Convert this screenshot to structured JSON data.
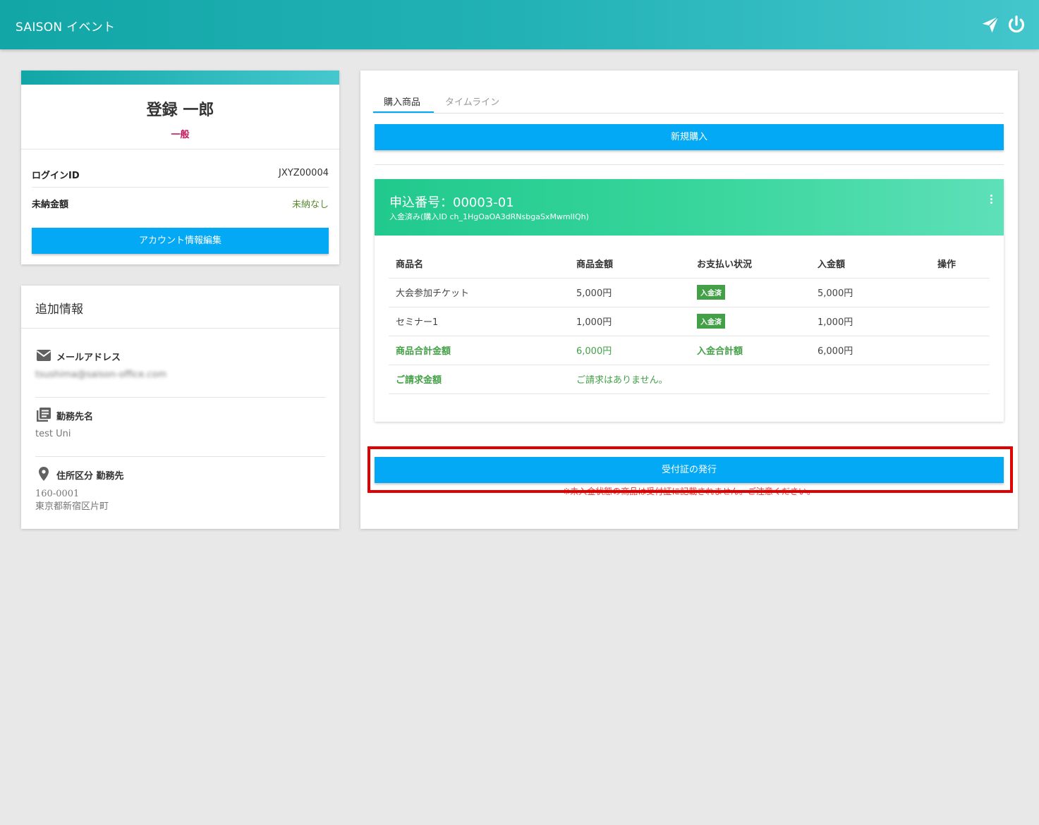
{
  "app": {
    "title": "SAISON イベント"
  },
  "header_icons": {
    "send": "send-icon",
    "power": "power-icon"
  },
  "profile": {
    "name": "登録 一郎",
    "role": "一般",
    "login_label": "ログインID",
    "login_value": "JXYZ00004",
    "unpaid_label": "未納金額",
    "unpaid_value": "未納なし",
    "edit_button": "アカウント情報編集"
  },
  "extra": {
    "title": "追加情報",
    "email_label": "メールアドレス",
    "email_value": "tsushima@saison-office.com",
    "company_label": "勤務先名",
    "company_value": "test Uni",
    "address_label": "住所区分 勤務先",
    "postal": "160-0001",
    "address": "東京都新宿区片町"
  },
  "tabs": [
    {
      "label": "購入商品",
      "active": true
    },
    {
      "label": "タイムライン",
      "active": false
    }
  ],
  "new_purchase_button": "新規購入",
  "order": {
    "title": "申込番号：00003-01",
    "subtitle": "入金済み(購入ID ch_1HgOaOA3dRNsbgaSxMwmlIQh)",
    "columns": [
      "商品名",
      "商品金額",
      "お支払い状況",
      "入金額",
      "操作"
    ],
    "rows": [
      {
        "name": "大会参加チケット",
        "price": "5,000円",
        "status": "入金済",
        "paid": "5,000円"
      },
      {
        "name": "セミナー1",
        "price": "1,000円",
        "status": "入金済",
        "paid": "1,000円"
      }
    ],
    "total_label": "商品合計金額",
    "total_value": "6,000円",
    "paid_total_label": "入金合計額",
    "paid_total_value": "6,000円",
    "billing_label": "ご請求金額",
    "billing_value": "ご請求はありません。"
  },
  "receipt_button": "受付証の発行",
  "receipt_note": "※未入金状態の商品は受付証に記載されません。ご注意ください。",
  "colors": {
    "header": "#22b2b6",
    "primary_button": "#03a9f4",
    "order_header": "#37d59b",
    "badge": "#43a047",
    "highlight": "#e00000"
  }
}
